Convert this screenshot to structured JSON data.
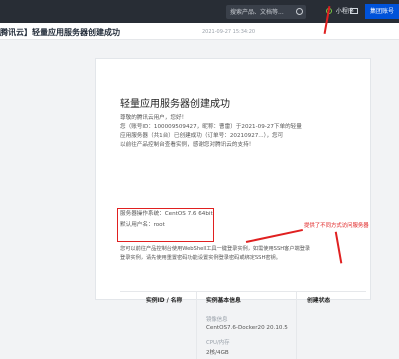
{
  "topbar": {
    "search_placeholder": "搜索产品、文档等...",
    "mini_program_label": "小程序",
    "team_button_label": "集团账号",
    "colors": {
      "bg": "#282d35",
      "accent": "#0052d9"
    }
  },
  "title": {
    "text": "腾讯云】轻量应用服务器创建成功",
    "time": "2021-09-27 15:34:20"
  },
  "email": {
    "heading": "轻量应用服务器创建成功",
    "greeting": "尊敬的腾讯云用户，您好！",
    "line1": "您（账号ID：100009509427，昵称：曹雷）于2021-09-27下单的轻量",
    "line2": "应用服务器（共1台）已创建成功（订单号：20210927...），您可",
    "line3": "以前往产品控制台查看实例，感谢您对腾讯云的支持！",
    "os_line": "服务器操作系统：CentOS 7.6 64bit",
    "user_line": "默认用户名：root",
    "note": "提供了不同方式访问服务器",
    "access1": "您可以前往产品控制台使用WebShell工具一键登录实例，如需使用SSH客户端登录",
    "access2": "登录实例，请先使用重置密码功能设置实例登录密码或绑定SSH密钥。",
    "link_login": "一键登录实例",
    "link_reset": "重置密码",
    "link_bind": "绑定SSH密钥"
  },
  "table": {
    "headers": [
      "实例ID / 名称",
      "实例基本信息",
      "创建状态"
    ],
    "rows": [
      {
        "label_image": "镜像信息",
        "image": "CentOS7.6-Docker20 20.10.5",
        "label_cpu": "CPU/内存",
        "cpu": "2核/4GB"
      }
    ]
  }
}
